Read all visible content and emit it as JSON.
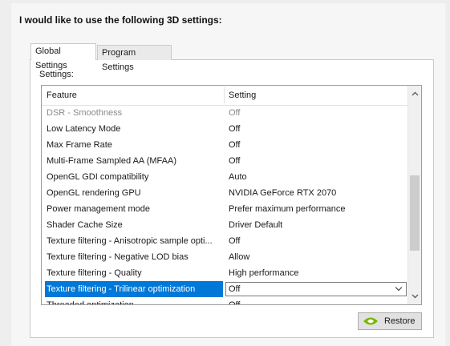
{
  "heading": "I would like to use the following 3D settings:",
  "tabs": [
    {
      "label": "Global Settings"
    },
    {
      "label": "Program Settings"
    }
  ],
  "settings_label": "Settings:",
  "columns": {
    "feature": "Feature",
    "setting": "Setting"
  },
  "rows": [
    {
      "feature": "DSR - Smoothness",
      "setting": "Off"
    },
    {
      "feature": "Low Latency Mode",
      "setting": "Off"
    },
    {
      "feature": "Max Frame Rate",
      "setting": "Off"
    },
    {
      "feature": "Multi-Frame Sampled AA (MFAA)",
      "setting": "Off"
    },
    {
      "feature": "OpenGL GDI compatibility",
      "setting": "Auto"
    },
    {
      "feature": "OpenGL rendering GPU",
      "setting": "NVIDIA GeForce RTX 2070"
    },
    {
      "feature": "Power management mode",
      "setting": "Prefer maximum performance"
    },
    {
      "feature": "Shader Cache Size",
      "setting": "Driver Default"
    },
    {
      "feature": "Texture filtering - Anisotropic sample opti...",
      "setting": "Off"
    },
    {
      "feature": "Texture filtering - Negative LOD bias",
      "setting": "Allow"
    },
    {
      "feature": "Texture filtering - Quality",
      "setting": "High performance"
    },
    {
      "feature": "Texture filtering - Trilinear optimization",
      "setting": "Off"
    },
    {
      "feature": "Threaded optimization",
      "setting": "Off"
    }
  ],
  "disabled_row_index": 0,
  "selected_row_index": 11,
  "restore": {
    "label": "Restore",
    "icon": "nvidia-icon"
  },
  "colors": {
    "selection": "#0078d7",
    "disabled_text": "#8a8a8a",
    "nvidia_green": "#76b900"
  }
}
